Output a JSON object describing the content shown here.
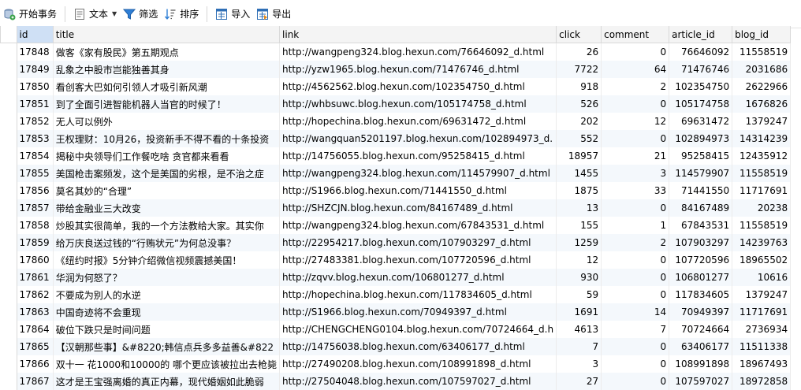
{
  "toolbar": {
    "begin_transaction": "开始事务",
    "text": "文本",
    "filter": "筛选",
    "sort": "排序",
    "import": "导入",
    "export": "导出"
  },
  "columns": [
    "id",
    "title",
    "link",
    "click",
    "comment",
    "article_id",
    "blog_id"
  ],
  "rows": [
    [
      "17848",
      "做客《家有股民》第五期观点",
      "http://wangpeng324.blog.hexun.com/76646092_d.html",
      "26",
      "0",
      "76646092",
      "11558519"
    ],
    [
      "17849",
      "乱象之中股市岂能独善其身",
      "http://yzw1965.blog.hexun.com/71476746_d.html",
      "7722",
      "64",
      "71476746",
      "2031686"
    ],
    [
      "17850",
      "看创客大巴如何引领人才吸引新风潮",
      "http://4562562.blog.hexun.com/102354750_d.html",
      "918",
      "2",
      "102354750",
      "2622966"
    ],
    [
      "17851",
      "到了全面引进智能机器人当官的时候了！",
      "http://whbsuwc.blog.hexun.com/105174758_d.html",
      "526",
      "0",
      "105174758",
      "1676826"
    ],
    [
      "17852",
      "无人可以例外",
      "http://hopechina.blog.hexun.com/69631472_d.html",
      "202",
      "12",
      "69631472",
      "1379247"
    ],
    [
      "17853",
      "王权理财：10月26，投资新手不得不看的十条投资",
      "http://wangquan5201197.blog.hexun.com/102894973_d.",
      "552",
      "0",
      "102894973",
      "14314239"
    ],
    [
      "17854",
      "揭秘中央领导们工作餐吃啥 贪官都来看看",
      "http://14756055.blog.hexun.com/95258415_d.html",
      "18957",
      "21",
      "95258415",
      "12435912"
    ],
    [
      "17855",
      "美国枪击案频发，这个是美国的劣根，是不治之症",
      "http://wangpeng324.blog.hexun.com/114579907_d.html",
      "1455",
      "3",
      "114579907",
      "11558519"
    ],
    [
      "17856",
      "莫名其妙的“合理”",
      "http://S1966.blog.hexun.com/71441550_d.html",
      "1875",
      "33",
      "71441550",
      "11717691"
    ],
    [
      "17857",
      "带给金融业三大改变",
      "http://SHZCJN.blog.hexun.com/84167489_d.html",
      "13",
      "0",
      "84167489",
      "20238"
    ],
    [
      "17858",
      "炒股其实很简单，我的一个方法教给大家。其实你",
      "http://wangpeng324.blog.hexun.com/67843531_d.html",
      "155",
      "1",
      "67843531",
      "11558519"
    ],
    [
      "17859",
      "给万庆良送过钱的“行贿状元”为何总没事？",
      "http://22954217.blog.hexun.com/107903297_d.html",
      "1259",
      "2",
      "107903297",
      "14239763"
    ],
    [
      "17860",
      "《纽约时报》5分钟介绍微信视频震撼美国！",
      "http://27483381.blog.hexun.com/107720596_d.html",
      "12",
      "0",
      "107720596",
      "18965502"
    ],
    [
      "17861",
      "华润为何怒了？",
      "http://zqvv.blog.hexun.com/106801277_d.html",
      "930",
      "0",
      "106801277",
      "10616"
    ],
    [
      "17862",
      "不要成为别人的水逆",
      "http://hopechina.blog.hexun.com/117834605_d.html",
      "59",
      "0",
      "117834605",
      "1379247"
    ],
    [
      "17863",
      "中国奇迹将不会重现",
      "http://S1966.blog.hexun.com/70949397_d.html",
      "1691",
      "14",
      "70949397",
      "11717691"
    ],
    [
      "17864",
      "破位下跌只是时间问题",
      "http://CHENGCHENG0104.blog.hexun.com/70724664_d.h",
      "4613",
      "7",
      "70724664",
      "2736934"
    ],
    [
      "17865",
      "【汉朝那些事】&#8220;韩信点兵多多益善&#822",
      "http://14756038.blog.hexun.com/63406177_d.html",
      "7",
      "0",
      "63406177",
      "11511338"
    ],
    [
      "17866",
      "双十一 花1000和10000的 哪个更应该被拉出去枪毙",
      "http://27490208.blog.hexun.com/108991898_d.html",
      "3",
      "0",
      "108991898",
      "18967493"
    ],
    [
      "17867",
      "这才是王宝强离婚的真正内幕，现代婚姻如此脆弱",
      "http://27504048.blog.hexun.com/107597027_d.html",
      "27",
      "0",
      "107597027",
      "18972858"
    ]
  ],
  "colors": {
    "selected_header": "#cfe0f5",
    "alt_row": "#f4f8fc",
    "icon_blue": "#2f7fd6"
  },
  "icons": [
    "begin-transaction-icon",
    "text-icon",
    "filter-icon",
    "sort-icon",
    "import-icon",
    "export-icon"
  ]
}
